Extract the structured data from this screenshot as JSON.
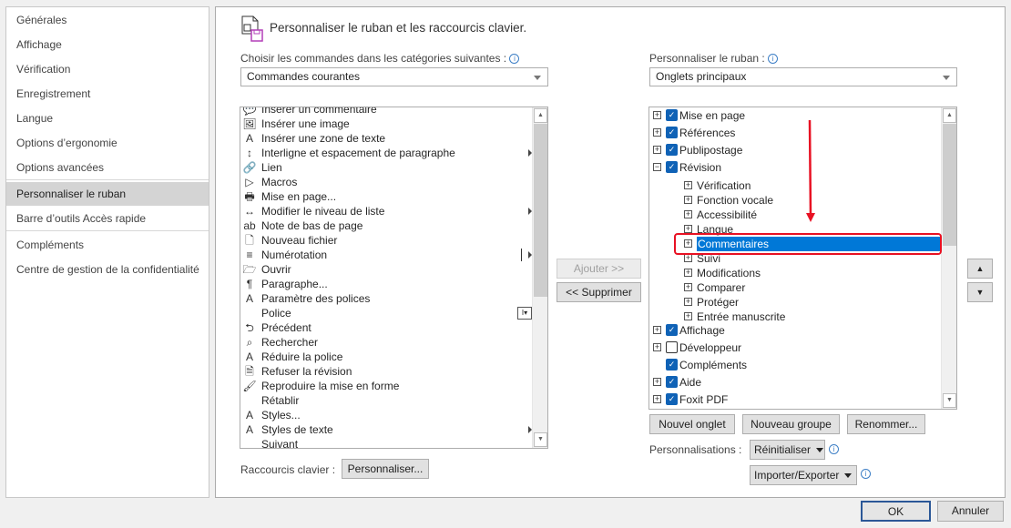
{
  "sidebar": {
    "items": [
      {
        "label": "Générales"
      },
      {
        "label": "Affichage"
      },
      {
        "label": "Vérification"
      },
      {
        "label": "Enregistrement"
      },
      {
        "label": "Langue"
      },
      {
        "label": "Options d’ergonomie"
      },
      {
        "label": "Options avancées"
      },
      {
        "label": "Personnaliser le ruban",
        "selected": true
      },
      {
        "label": "Barre d’outils Accès rapide"
      },
      {
        "label": "Compléments"
      },
      {
        "label": "Centre de gestion de la confidentialité"
      }
    ]
  },
  "header": {
    "title": "Personnaliser le ruban et les raccourcis clavier.",
    "icon": "customize-ribbon-icon"
  },
  "commands": {
    "label": "Choisir les commandes dans les catégories suivantes :",
    "info": "i",
    "selected": "Commandes courantes",
    "items": [
      {
        "label": "Insérer un commentaire",
        "icon": "💬"
      },
      {
        "label": "Insérer une image",
        "icon": "🖼"
      },
      {
        "label": "Insérer une zone de texte",
        "icon": "A"
      },
      {
        "label": "Interligne et espacement de paragraphe",
        "icon": "↕",
        "submenu": true
      },
      {
        "label": "Lien",
        "icon": "🔗"
      },
      {
        "label": "Macros",
        "icon": "▷"
      },
      {
        "label": "Mise en page...",
        "icon": "🖶"
      },
      {
        "label": "Modifier le niveau de liste",
        "icon": "↔",
        "submenu": true
      },
      {
        "label": "Note de bas de page",
        "icon": "ab"
      },
      {
        "label": "Nouveau fichier",
        "icon": "🗋"
      },
      {
        "label": "Numérotation",
        "icon": "≡",
        "split": true
      },
      {
        "label": "Ouvrir",
        "icon": "🗁"
      },
      {
        "label": "Paragraphe...",
        "icon": "¶"
      },
      {
        "label": "Paramètre des polices",
        "icon": "A"
      },
      {
        "label": "Police",
        "icon": "",
        "combo": true
      },
      {
        "label": "Précédent",
        "icon": "⮌"
      },
      {
        "label": "Rechercher",
        "icon": "⌕"
      },
      {
        "label": "Réduire la police",
        "icon": "A"
      },
      {
        "label": "Refuser la révision",
        "icon": "🗎"
      },
      {
        "label": "Reproduire la mise en forme",
        "icon": "🖌"
      },
      {
        "label": "Rétablir",
        "icon": ""
      },
      {
        "label": "Styles...",
        "icon": "A"
      },
      {
        "label": "Styles de texte",
        "icon": "A",
        "submenu": true
      },
      {
        "label": "Suivant",
        "icon": ""
      }
    ]
  },
  "ribbon": {
    "label": "Personnaliser le ruban :",
    "info": "i",
    "selected": "Onglets principaux",
    "items": [
      {
        "label": "Mise en page",
        "level": 0,
        "expander": "+",
        "checked": true
      },
      {
        "label": "Références",
        "level": 0,
        "expander": "+",
        "checked": true
      },
      {
        "label": "Publipostage",
        "level": 0,
        "expander": "+",
        "checked": true
      },
      {
        "label": "Révision",
        "level": 0,
        "expander": "−",
        "checked": true
      },
      {
        "label": "Vérification",
        "level": 1,
        "expander": "+"
      },
      {
        "label": "Fonction vocale",
        "level": 1,
        "expander": "+"
      },
      {
        "label": "Accessibilité",
        "level": 1,
        "expander": "+"
      },
      {
        "label": "Langue",
        "level": 1,
        "expander": "+"
      },
      {
        "label": "Commentaires",
        "level": 1,
        "expander": "+",
        "selected": true
      },
      {
        "label": "Suivi",
        "level": 1,
        "expander": "+"
      },
      {
        "label": "Modifications",
        "level": 1,
        "expander": "+"
      },
      {
        "label": "Comparer",
        "level": 1,
        "expander": "+"
      },
      {
        "label": "Protéger",
        "level": 1,
        "expander": "+"
      },
      {
        "label": "Entrée manuscrite",
        "level": 1,
        "expander": "+"
      },
      {
        "label": "Affichage",
        "level": 0,
        "expander": "+",
        "checked": true
      },
      {
        "label": "Développeur",
        "level": 0,
        "expander": "+",
        "checked": false
      },
      {
        "label": "Compléments",
        "level": 0,
        "expander": "",
        "checked": true
      },
      {
        "label": "Aide",
        "level": 0,
        "expander": "+",
        "checked": true
      },
      {
        "label": "Foxit PDF",
        "level": 0,
        "expander": "+",
        "checked": true
      }
    ]
  },
  "buttons": {
    "add": "Ajouter >>",
    "remove": "<< Supprimer",
    "up": "▲",
    "down": "▼",
    "new_tab": "Nouvel onglet",
    "new_group": "Nouveau groupe",
    "rename": "Renommer...",
    "reset": "Réinitialiser",
    "import_export": "Importer/Exporter",
    "ok": "OK",
    "cancel": "Annuler"
  },
  "customizations_label": "Personnalisations :",
  "shortcuts": {
    "label": "Raccourcis clavier :",
    "button": "Personnaliser..."
  },
  "colors": {
    "accent": "#0078d7",
    "highlight": "#e81123"
  }
}
